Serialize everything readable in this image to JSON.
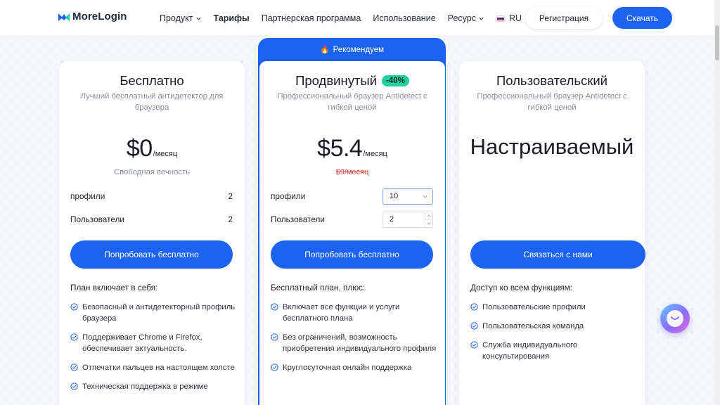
{
  "header": {
    "logo_text": "MoreLogin",
    "nav": [
      {
        "label": "Продукт",
        "has_dropdown": true,
        "active": false
      },
      {
        "label": "Тарифы",
        "has_dropdown": false,
        "active": true
      },
      {
        "label": "Партнерская программа",
        "has_dropdown": false,
        "active": false
      },
      {
        "label": "Использование",
        "has_dropdown": false,
        "active": false
      },
      {
        "label": "Ресурс",
        "has_dropdown": true,
        "active": false
      }
    ],
    "language": "RU",
    "register_label": "Регистрация",
    "download_label": "Скачать"
  },
  "colors": {
    "accent": "#1b63f0",
    "badge": "#1fcfa0",
    "old_price": "#e0494a"
  },
  "plans": {
    "free": {
      "title": "Бесплатно",
      "subtitle": "Лучший бесплатный антидетектор для браузера",
      "price": "$0",
      "per": "/месяц",
      "price_note": "Свободная вечность",
      "profiles_label": "профили",
      "profiles_value": "2",
      "users_label": "Пользователи",
      "users_value": "2",
      "cta": "Попробовать бесплатно",
      "includes": "План включает в себя:",
      "features": [
        "Безопасный и антидетекторный профиль браузера",
        "Поддерживает Chrome и Firefox, обеспечивает актуальность.",
        "Отпечатки пальцев на настоящем холсте",
        "Техническая поддержка в режиме"
      ]
    },
    "pro": {
      "recommend": "Рекомендуем",
      "title": "Продвинутый",
      "discount": "-40%",
      "subtitle": "Профессиональный браузер Antidetect с гибкой ценой",
      "price": "$5.4",
      "per": "/месяц",
      "old_price": "$9/месяц",
      "profiles_label": "профили",
      "profiles_select": "10",
      "users_label": "Пользователи",
      "users_value": "2",
      "cta": "Попробовать бесплатно",
      "includes": "Бесплатный план, плюс:",
      "features": [
        "Включает все функции и услуги бесплатного плана",
        "Без ограничений, возможность приобретения индивидуального профиля",
        "Круглосуточная онлайн поддержка"
      ]
    },
    "custom": {
      "title": "Пользовательский",
      "subtitle": "Профессиональный браузер Antidetect с гибкой ценой",
      "price_label": "Настраиваемый",
      "cta": "Связаться с нами",
      "includes": "Доступ ко всем функциям:",
      "features": [
        "Пользовательские профили",
        "Пользовательская команда",
        "Служба индивидуального консультирования"
      ]
    }
  }
}
